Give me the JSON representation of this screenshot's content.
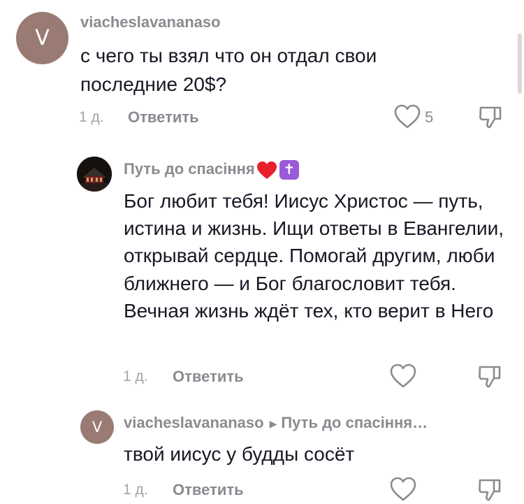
{
  "comments": [
    {
      "avatar_letter": "V",
      "username": "viacheslavananaso",
      "text": "с чего ты взял что он отдал свои последние 20$?",
      "time": "1 д.",
      "reply_label": "Ответить",
      "likes": "5"
    },
    {
      "username": "Путь до спасіння",
      "text": "Бог любит тебя! Иисус Христос — путь, истина и жизнь. Ищи ответы в Евангелии, открывай сердце. Помогай другим, люби ближнего — и Бог благословит тебя. Вечная жизнь ждёт тех, кто верит в Него",
      "time": "1 д.",
      "reply_label": "Ответить",
      "emoji_cross": "✝"
    },
    {
      "avatar_letter": "V",
      "username": "viacheslavananaso",
      "reply_to": "Путь до спасіння…",
      "text": "твой иисус у будды сосёт",
      "time": "1 д.",
      "reply_label": "Ответить"
    }
  ],
  "icons": {
    "like": "heart-outline-icon",
    "dislike": "thumbs-down-outline-icon",
    "reply_arrow": "triangle-right-icon",
    "emoji_heart": "red-heart-emoji",
    "emoji_cross": "latin-cross-emoji"
  },
  "colors": {
    "avatar": "#9a7b74",
    "username": "#8a8b91",
    "text": "#161823",
    "meta": "#a3a4a8",
    "emoji_heart": "#e8202a",
    "emoji_cross_bg": "#9a5ad8"
  }
}
